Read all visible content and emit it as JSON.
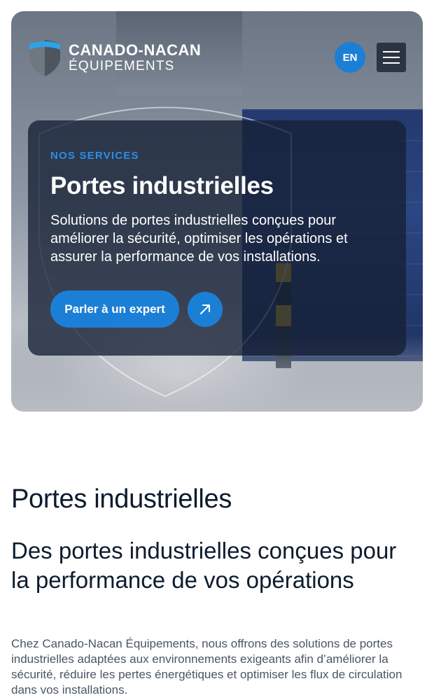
{
  "header": {
    "logo": {
      "line1": "CANADO-NACAN",
      "line2": "ÉQUIPEMENTS"
    },
    "language_toggle": "EN",
    "menu_icon": "hamburger-menu-icon"
  },
  "hero": {
    "eyebrow": "NOS SERVICES",
    "title": "Portes industrielles",
    "description": "Solutions de portes industrielles conçues pour améliorer la sécurité, optimiser les opérations et assurer la performance de vos installations.",
    "cta_label": "Parler à un expert",
    "arrow_icon": "arrow-up-right-icon"
  },
  "main": {
    "title": "Portes industrielles",
    "heading": "Des portes industrielles conçues pour la performance de vos opérations",
    "intro": "Chez Canado-Nacan Équipements, nous offrons des solutions de portes industrielles adaptées aux environnements exigeants afin d’améliorer la sécurité, réduire les pertes énergétiques et optimiser les flux de circulation dans vos installations."
  },
  "colors": {
    "accent": "#1c7fd6",
    "heading_text": "#0d1b2e",
    "body_text": "#4a5566",
    "card_overlay": "#162034"
  }
}
